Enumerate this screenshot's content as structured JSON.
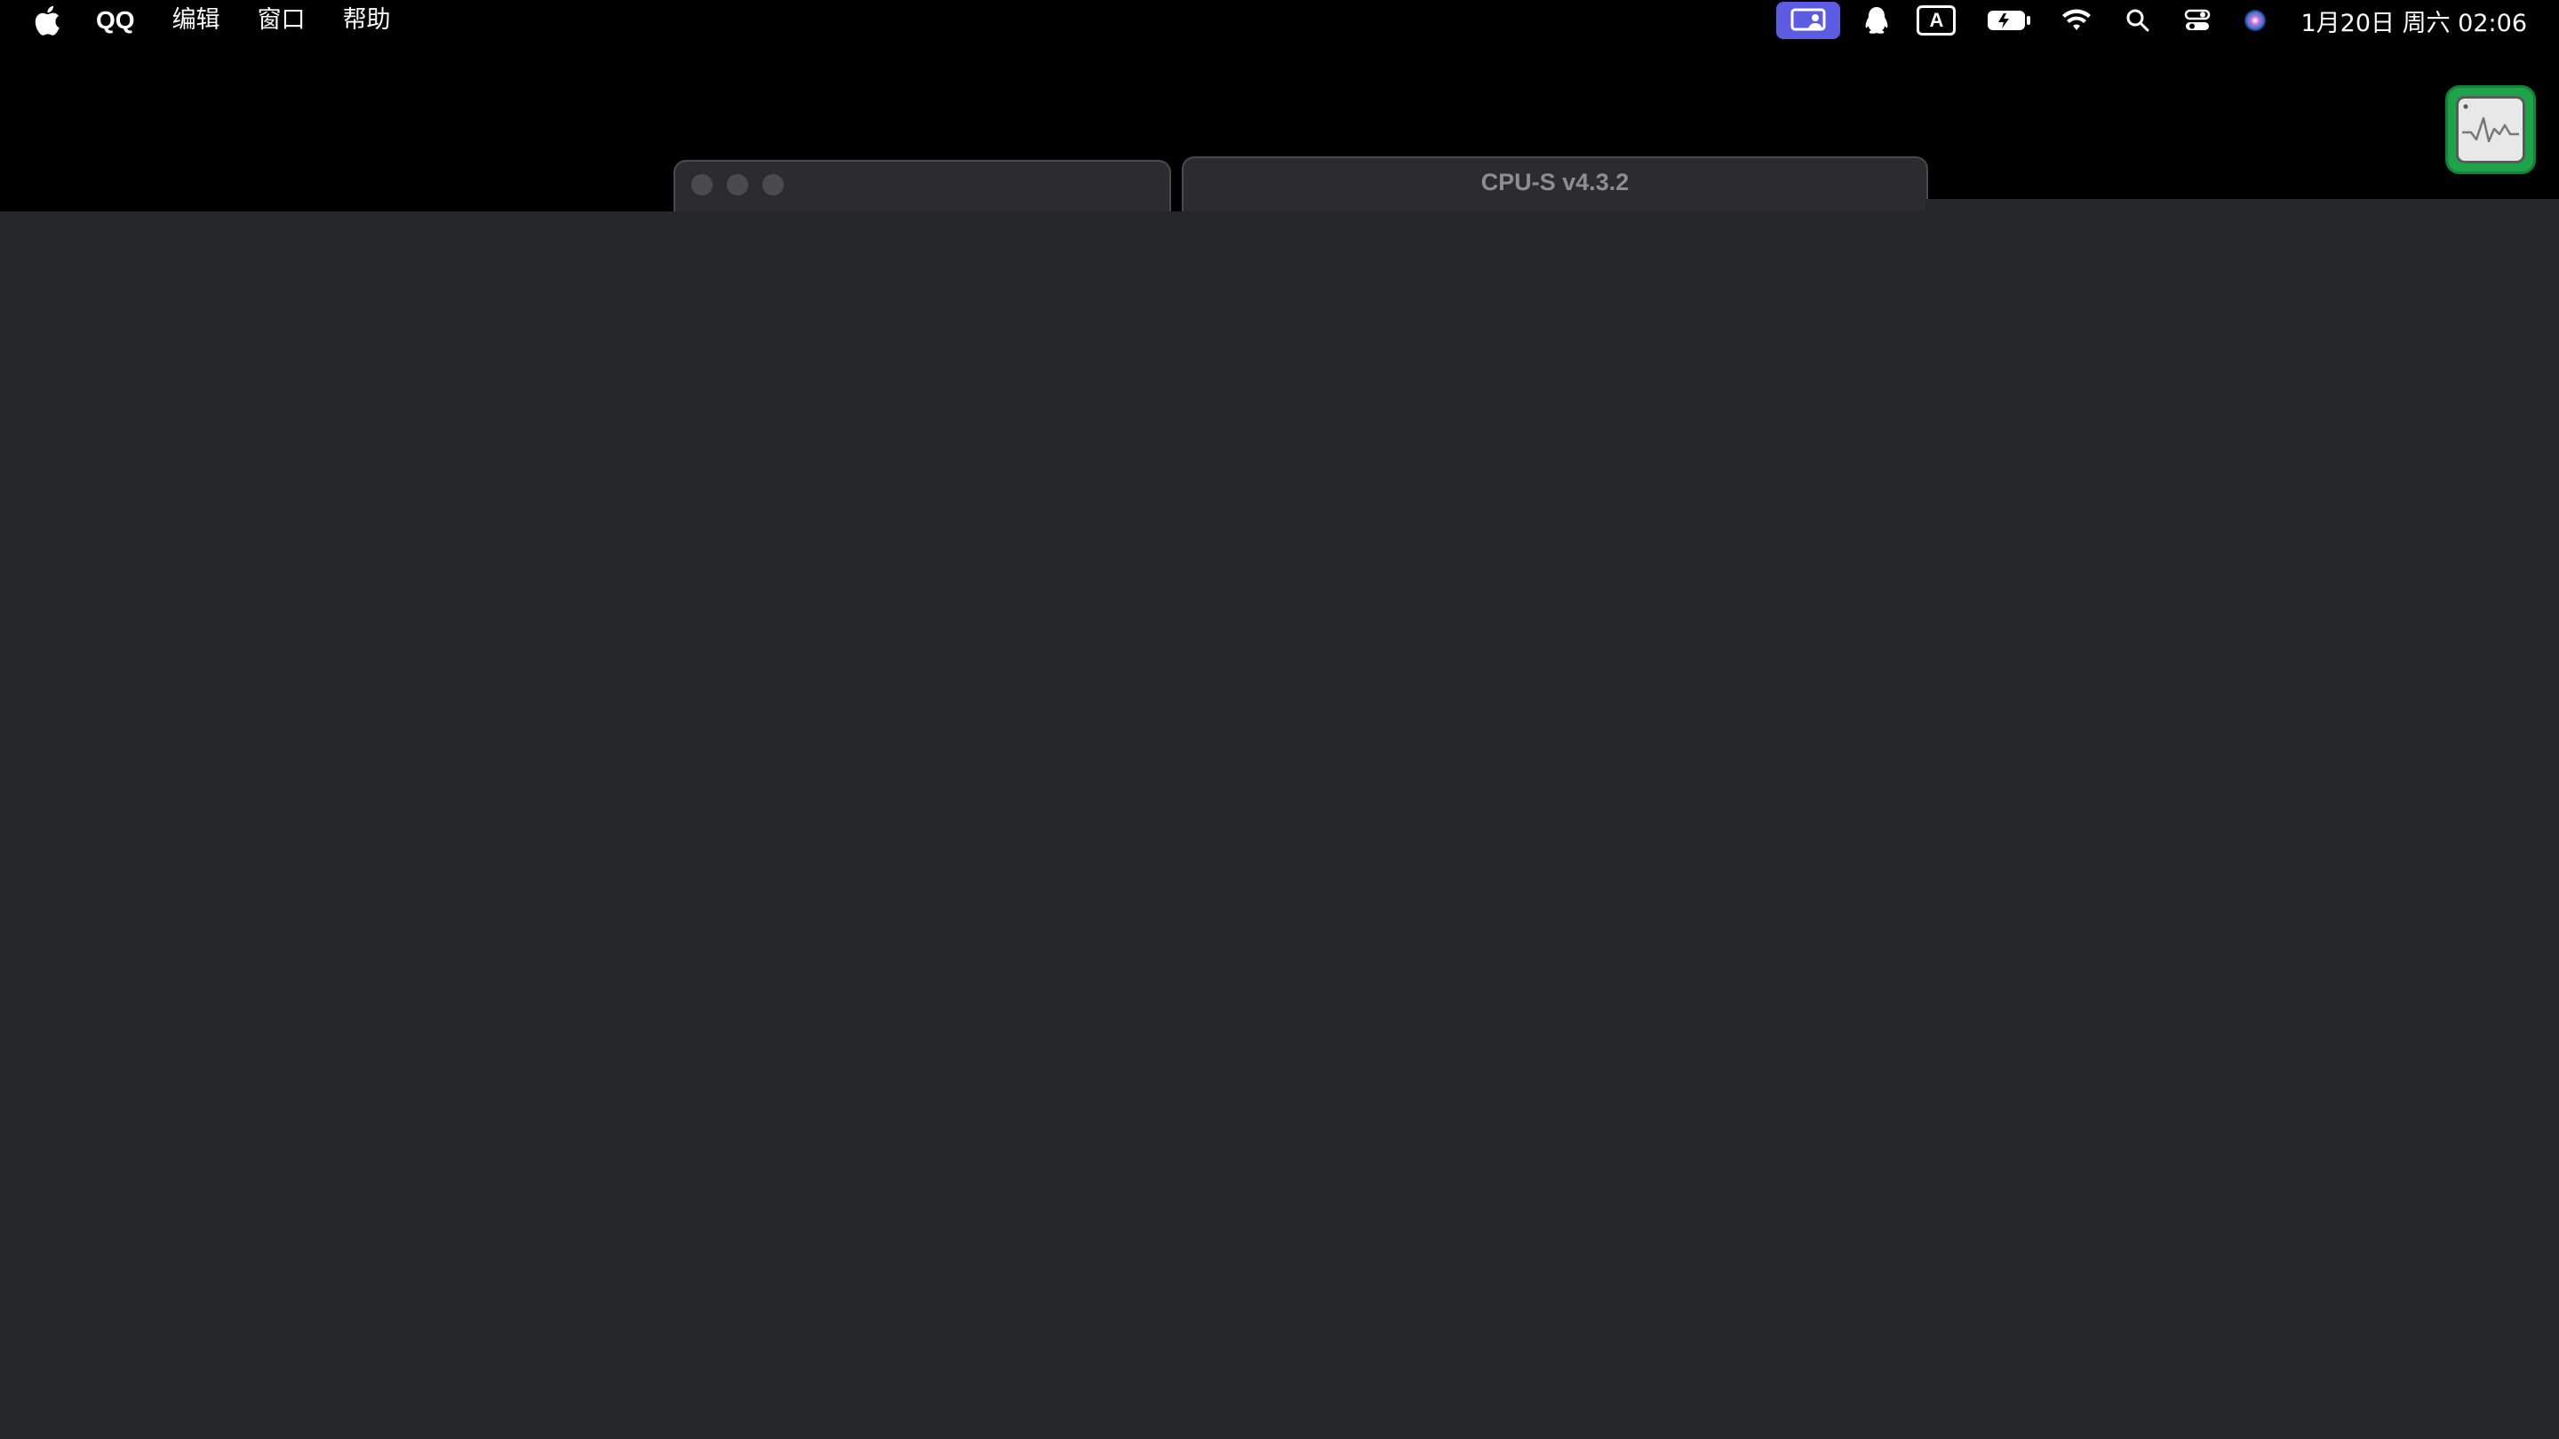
{
  "menubar": {
    "app_name": "QQ",
    "items": [
      "编辑",
      "窗口",
      "帮助"
    ],
    "status": {
      "input_method": "A",
      "clock": "1月20日 周六  02:06"
    },
    "icons": [
      "apple-logo-icon",
      "screen-share-icon",
      "qq-penguin-icon",
      "input-method-icon",
      "battery-icon",
      "wifi-icon",
      "search-icon",
      "control-center-icon",
      "siri-icon"
    ]
  },
  "windows": {
    "cpu_window_title": "CPU-S v4.3.2"
  },
  "widgets": {
    "activity_monitor_icon": "activity-monitor-icon"
  },
  "colors": {
    "menubar_bg": "#000000",
    "window_bg": "#262729",
    "screen_share_accent": "#5b5ce2",
    "activity_green": "#1fa34a"
  }
}
